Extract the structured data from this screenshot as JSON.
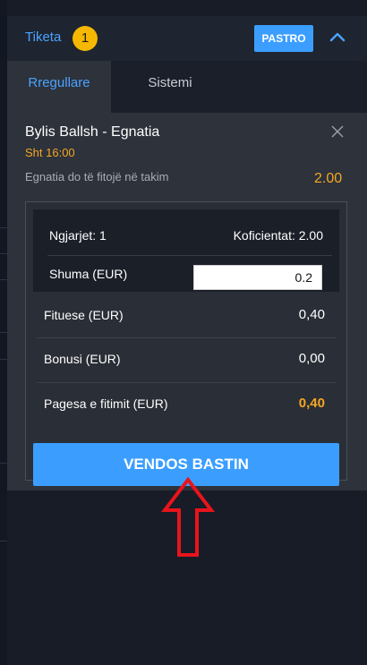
{
  "header": {
    "title": "Tiketa",
    "selection_count": "1",
    "clear_label": "PASTRO",
    "collapse_icon": "chevron-up-icon"
  },
  "tabs": [
    {
      "label": "Rregullare",
      "active": true
    },
    {
      "label": "Sistemi",
      "active": false
    }
  ],
  "selection": {
    "event": "Bylis Ballsh - Egnatia",
    "time": "Sht 16:00",
    "market": "Egnatia do të fitojë në takim",
    "odds": "2.00",
    "remove_icon": "close-icon"
  },
  "summary": {
    "events_count": "Ngjarjet: 1",
    "total_odds": "Koficientat: 2.00",
    "stake_label": "Shuma (EUR)",
    "stake_value": "0.2",
    "winnings_label": "Fituese (EUR)",
    "winnings_value": "0,40",
    "bonus_label": "Bonusi (EUR)",
    "bonus_value": "0,00",
    "payout_label": "Pagesa e fitimit (EUR)",
    "payout_value": "0,40"
  },
  "place_bet_label": "VENDOS BASTIN",
  "annotation_icon": "red-arrow-up-icon",
  "colors": {
    "accent_blue": "#3b9eff",
    "accent_orange": "#f5a623",
    "badge_yellow": "#f5b700",
    "panel_bg": "#2d323b",
    "page_bg": "#171c27",
    "annotation_red": "#e8141c"
  }
}
